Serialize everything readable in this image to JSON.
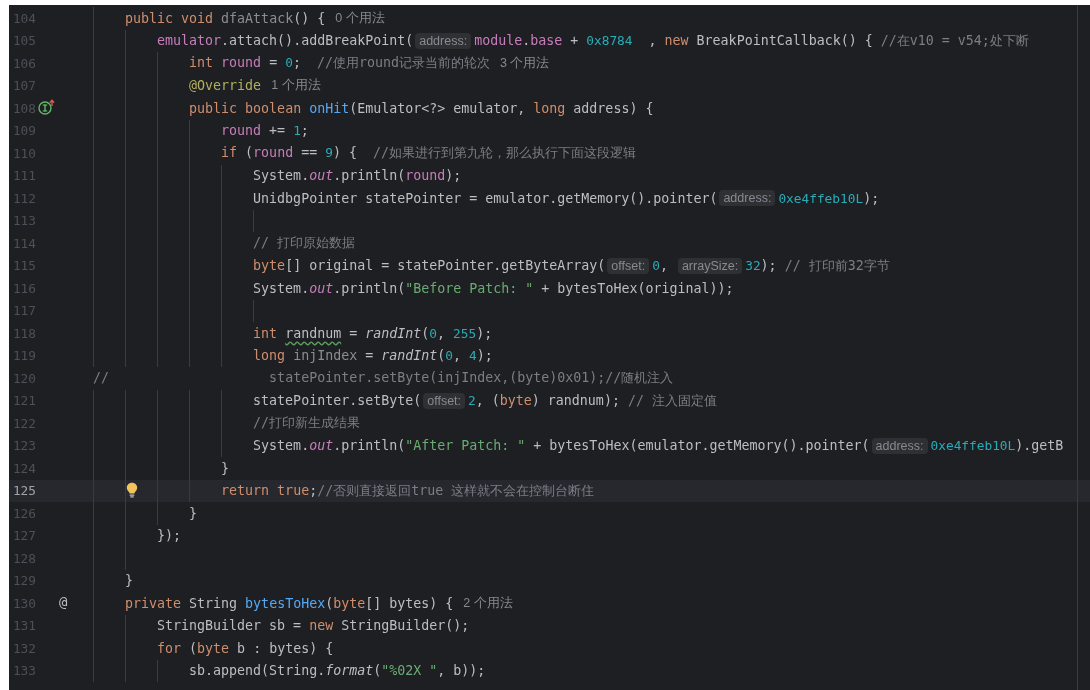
{
  "editor": {
    "lines": [
      {
        "number": "104",
        "current": false,
        "tokens": [
          {
            "kind": "kw",
            "text": "    public void "
          },
          {
            "kind": "unused",
            "text": "dfaAttack"
          },
          {
            "kind": "plain",
            "text": "() {"
          },
          {
            "kind": "usage",
            "text": "0 个用法"
          }
        ]
      },
      {
        "number": "105",
        "current": false,
        "tokens": [
          {
            "kind": "field",
            "text": "        emulator"
          },
          {
            "kind": "plain",
            "text": ".attach().addBreakPoint("
          },
          {
            "kind": "hint",
            "text": "address:"
          },
          {
            "kind": "field",
            "text": "module"
          },
          {
            "kind": "plain",
            "text": "."
          },
          {
            "kind": "field",
            "text": "base"
          },
          {
            "kind": "plain",
            "text": " + "
          },
          {
            "kind": "num",
            "text": "0x8784"
          },
          {
            "kind": "plain",
            "text": "  , "
          },
          {
            "kind": "kw",
            "text": "new"
          },
          {
            "kind": "plain",
            "text": " BreakPointCallback() { "
          },
          {
            "kind": "comment",
            "text": "//在v10 = v54;处下断"
          }
        ]
      },
      {
        "number": "106",
        "current": false,
        "tokens": [
          {
            "kind": "kw",
            "text": "            int "
          },
          {
            "kind": "field",
            "text": "round"
          },
          {
            "kind": "plain",
            "text": " = "
          },
          {
            "kind": "num",
            "text": "0"
          },
          {
            "kind": "plain",
            "text": ";  "
          },
          {
            "kind": "comment",
            "text": "//使用round记录当前的轮次"
          },
          {
            "kind": "usage",
            "text": "3 个用法"
          }
        ]
      },
      {
        "number": "107",
        "current": false,
        "tokens": [
          {
            "kind": "ann",
            "text": "            @Override"
          },
          {
            "kind": "usage",
            "text": "1 个用法"
          }
        ]
      },
      {
        "number": "108",
        "current": false,
        "gutter": {
          "kind": "implements"
        },
        "tokens": [
          {
            "kind": "kw",
            "text": "            public boolean "
          },
          {
            "kind": "fn",
            "text": "onHit"
          },
          {
            "kind": "plain",
            "text": "(Emulator<?> emulator, "
          },
          {
            "kind": "kw",
            "text": "long"
          },
          {
            "kind": "plain",
            "text": " address) {"
          }
        ]
      },
      {
        "number": "109",
        "current": false,
        "tokens": [
          {
            "kind": "field",
            "text": "                round"
          },
          {
            "kind": "plain",
            "text": " += "
          },
          {
            "kind": "num",
            "text": "1"
          },
          {
            "kind": "plain",
            "text": ";"
          }
        ]
      },
      {
        "number": "110",
        "current": false,
        "tokens": [
          {
            "kind": "kw",
            "text": "                if"
          },
          {
            "kind": "plain",
            "text": " ("
          },
          {
            "kind": "field",
            "text": "round"
          },
          {
            "kind": "plain",
            "text": " == "
          },
          {
            "kind": "num",
            "text": "9"
          },
          {
            "kind": "plain",
            "text": ") {  "
          },
          {
            "kind": "comment",
            "text": "//如果进行到第九轮，那么执行下面这段逻辑"
          }
        ]
      },
      {
        "number": "111",
        "current": false,
        "tokens": [
          {
            "kind": "plain",
            "text": "                    System."
          },
          {
            "kind": "static",
            "text": "out"
          },
          {
            "kind": "plain",
            "text": ".println("
          },
          {
            "kind": "field",
            "text": "round"
          },
          {
            "kind": "plain",
            "text": ");"
          }
        ]
      },
      {
        "number": "112",
        "current": false,
        "tokens": [
          {
            "kind": "plain",
            "text": "                    UnidbgPointer statePointer = emulator.getMemory().pointer("
          },
          {
            "kind": "hint",
            "text": "address:"
          },
          {
            "kind": "num",
            "text": "0xe4ffeb10L"
          },
          {
            "kind": "plain",
            "text": ");"
          }
        ]
      },
      {
        "number": "113",
        "current": false
      },
      {
        "number": "114",
        "current": false,
        "tokens": [
          {
            "kind": "comment",
            "text": "                    // 打印原始数据"
          }
        ]
      },
      {
        "number": "115",
        "current": false,
        "tokens": [
          {
            "kind": "kw",
            "text": "                    byte"
          },
          {
            "kind": "plain",
            "text": "[] original = statePointer.getByteArray("
          },
          {
            "kind": "hint",
            "text": "offset:"
          },
          {
            "kind": "num",
            "text": "0"
          },
          {
            "kind": "plain",
            "text": ", "
          },
          {
            "kind": "hint",
            "text": "arraySize:"
          },
          {
            "kind": "num",
            "text": "32"
          },
          {
            "kind": "plain",
            "text": "); "
          },
          {
            "kind": "comment",
            "text": "// 打印前32字节"
          }
        ]
      },
      {
        "number": "116",
        "current": false,
        "tokens": [
          {
            "kind": "plain",
            "text": "                    System."
          },
          {
            "kind": "static",
            "text": "out"
          },
          {
            "kind": "plain",
            "text": ".println("
          },
          {
            "kind": "str",
            "text": "\"Before Patch: \""
          },
          {
            "kind": "plain",
            "text": " + bytesToHex(original));"
          }
        ]
      },
      {
        "number": "117",
        "current": false
      },
      {
        "number": "118",
        "current": false,
        "tokens": [
          {
            "kind": "kw",
            "text": "                    int "
          },
          {
            "kind": "typo",
            "text": "randnum"
          },
          {
            "kind": "plain",
            "text": " = "
          },
          {
            "kind": "italic",
            "text": "randInt"
          },
          {
            "kind": "plain",
            "text": "("
          },
          {
            "kind": "num",
            "text": "0"
          },
          {
            "kind": "plain",
            "text": ", "
          },
          {
            "kind": "num",
            "text": "255"
          },
          {
            "kind": "plain",
            "text": ");"
          }
        ]
      },
      {
        "number": "119",
        "current": false,
        "tokens": [
          {
            "kind": "kw",
            "text": "                    long "
          },
          {
            "kind": "unused",
            "text": "injIndex"
          },
          {
            "kind": "plain",
            "text": " = "
          },
          {
            "kind": "italic",
            "text": "randInt"
          },
          {
            "kind": "plain",
            "text": "("
          },
          {
            "kind": "num",
            "text": "0"
          },
          {
            "kind": "plain",
            "text": ", "
          },
          {
            "kind": "num",
            "text": "4"
          },
          {
            "kind": "plain",
            "text": ");"
          }
        ]
      },
      {
        "number": "120",
        "current": false,
        "tokens": [
          {
            "kind": "comment",
            "text": "//                    statePointer.setByte(injIndex,(byte)0x01);//随机注入"
          }
        ]
      },
      {
        "number": "121",
        "current": false,
        "tokens": [
          {
            "kind": "plain",
            "text": "                    statePointer.setByte("
          },
          {
            "kind": "hint",
            "text": "offset:"
          },
          {
            "kind": "num",
            "text": "2"
          },
          {
            "kind": "plain",
            "text": ", ("
          },
          {
            "kind": "kw",
            "text": "byte"
          },
          {
            "kind": "plain",
            "text": ") randnum); "
          },
          {
            "kind": "comment",
            "text": "// 注入固定值"
          }
        ]
      },
      {
        "number": "122",
        "current": false,
        "tokens": [
          {
            "kind": "comment",
            "text": "                    //打印新生成结果"
          }
        ]
      },
      {
        "number": "123",
        "current": false,
        "tokens": [
          {
            "kind": "plain",
            "text": "                    System."
          },
          {
            "kind": "static",
            "text": "out"
          },
          {
            "kind": "plain",
            "text": ".println("
          },
          {
            "kind": "str",
            "text": "\"After Patch: \""
          },
          {
            "kind": "plain",
            "text": " + bytesToHex(emulator.getMemory().pointer("
          },
          {
            "kind": "hint",
            "text": "address:"
          },
          {
            "kind": "num",
            "text": "0xe4ffeb10L"
          },
          {
            "kind": "plain",
            "text": ").getB"
          }
        ]
      },
      {
        "number": "124",
        "current": false,
        "tokens": [
          {
            "kind": "plain",
            "text": "                }"
          }
        ]
      },
      {
        "number": "125",
        "current": true,
        "gutter": {
          "kind": "bulb"
        },
        "tokens": [
          {
            "kind": "kw",
            "text": "                return true"
          },
          {
            "kind": "plain",
            "text": ";"
          },
          {
            "kind": "comment",
            "text": "//否则直接返回true 这样就不会在控制台断住"
          }
        ]
      },
      {
        "number": "126",
        "current": false,
        "tokens": [
          {
            "kind": "plain",
            "text": "            }"
          }
        ]
      },
      {
        "number": "127",
        "current": false,
        "tokens": [
          {
            "kind": "plain",
            "text": "        });"
          }
        ]
      },
      {
        "number": "128",
        "current": false
      },
      {
        "number": "129",
        "current": false,
        "tokens": [
          {
            "kind": "plain",
            "text": "    }"
          }
        ]
      },
      {
        "number": "130",
        "current": false,
        "gutter": {
          "kind": "symbol",
          "text": "@"
        },
        "tokens": [
          {
            "kind": "kw",
            "text": "    private"
          },
          {
            "kind": "plain",
            "text": " String "
          },
          {
            "kind": "fn",
            "text": "bytesToHex"
          },
          {
            "kind": "plain",
            "text": "("
          },
          {
            "kind": "kw",
            "text": "byte"
          },
          {
            "kind": "plain",
            "text": "[] bytes) {"
          },
          {
            "kind": "usage",
            "text": "2 个用法"
          }
        ]
      },
      {
        "number": "131",
        "current": false,
        "tokens": [
          {
            "kind": "plain",
            "text": "        StringBuilder sb = "
          },
          {
            "kind": "kw",
            "text": "new"
          },
          {
            "kind": "plain",
            "text": " StringBuilder();"
          }
        ]
      },
      {
        "number": "132",
        "current": false,
        "tokens": [
          {
            "kind": "kw",
            "text": "        for"
          },
          {
            "kind": "plain",
            "text": " ("
          },
          {
            "kind": "kw",
            "text": "byte"
          },
          {
            "kind": "plain",
            "text": " b : bytes) {"
          }
        ]
      },
      {
        "number": "133",
        "current": false,
        "tokens": [
          {
            "kind": "plain",
            "text": "            sb.append(String."
          },
          {
            "kind": "italic",
            "text": "format"
          },
          {
            "kind": "plain",
            "text": "("
          },
          {
            "kind": "str",
            "text": "\"%02X \""
          },
          {
            "kind": "plain",
            "text": ", b));"
          }
        ]
      }
    ]
  }
}
